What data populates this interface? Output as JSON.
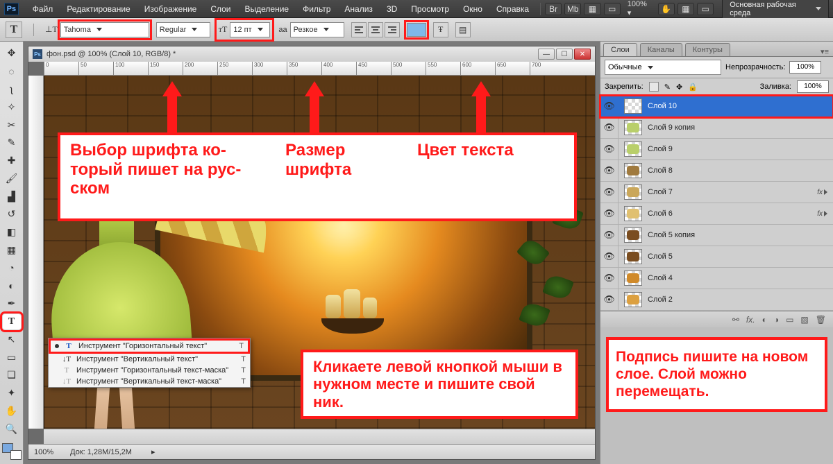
{
  "menu": {
    "items": [
      "Файл",
      "Редактирование",
      "Изображение",
      "Слои",
      "Выделение",
      "Фильтр",
      "Анализ",
      "3D",
      "Просмотр",
      "Окно",
      "Справка"
    ],
    "zoom": "100%",
    "workspace": "Основная рабочая среда"
  },
  "optbar": {
    "font": "Tahoma",
    "style": "Regular",
    "size": "12 пт",
    "aa": "Резкое",
    "color_swatch": "#7fb8e8",
    "aa_label": "aa",
    "size_icon": "тT"
  },
  "doc": {
    "title": "фон.psd @ 100% (Слой 10, RGB/8) *",
    "ruler_marks": [
      "0",
      "50",
      "100",
      "150",
      "200",
      "250",
      "300",
      "350",
      "400",
      "450",
      "500",
      "550",
      "600",
      "650",
      "700"
    ],
    "zoom": "100%",
    "status": "Док: 1,28M/15,2M"
  },
  "annotations": {
    "top1": "Выбор шрифта ко-\nторый пишет на рус-\nском",
    "top2": "Размер\nшрифта",
    "top3": "Цвет текста",
    "bottom": "Кликаете левой кнопкой мыши в нужном месте и пишите свой ник.",
    "side": "Подпись пишите на новом слое. Слой можно перемещать."
  },
  "flyout": {
    "items": [
      {
        "icon": "T",
        "label": "Инструмент \"Горизонтальный текст\"",
        "short": "T",
        "sel": true
      },
      {
        "icon": "T",
        "label": "Инструмент \"Вертикальный текст\"",
        "short": "T"
      },
      {
        "icon": "T",
        "label": "Инструмент \"Горизонтальный текст-маска\"",
        "short": "T"
      },
      {
        "icon": "T",
        "label": "Инструмент \"Вертикальный текст-маска\"",
        "short": "T"
      }
    ]
  },
  "panels": {
    "tabs": [
      "Слои",
      "Каналы",
      "Контуры"
    ],
    "blend_label": "Обычные",
    "opacity_label": "Непрозрачность:",
    "opacity_value": "100%",
    "lock_label": "Закрепить:",
    "fill_label": "Заливка:",
    "fill_value": "100%",
    "layers": [
      {
        "name": "Слой 10",
        "selected": true,
        "fx": false,
        "thumb": "transparent"
      },
      {
        "name": "Слой 9 копия",
        "fx": false,
        "thumb": "#b9cf6a"
      },
      {
        "name": "Слой 9",
        "fx": false,
        "thumb": "#b9cf6a"
      },
      {
        "name": "Слой 8",
        "fx": false,
        "thumb": "#a07a3e"
      },
      {
        "name": "Слой 7",
        "fx": true,
        "thumb": "#caa75a"
      },
      {
        "name": "Слой 6",
        "fx": true,
        "thumb": "#e0c070"
      },
      {
        "name": "Слой 5 копия",
        "fx": false,
        "thumb": "#7a4d20"
      },
      {
        "name": "Слой 5",
        "fx": false,
        "thumb": "#7a4d20"
      },
      {
        "name": "Слой 4",
        "fx": false,
        "thumb": "#d08a2a"
      },
      {
        "name": "Слой 2",
        "fx": false,
        "thumb": "#dca040"
      }
    ]
  }
}
